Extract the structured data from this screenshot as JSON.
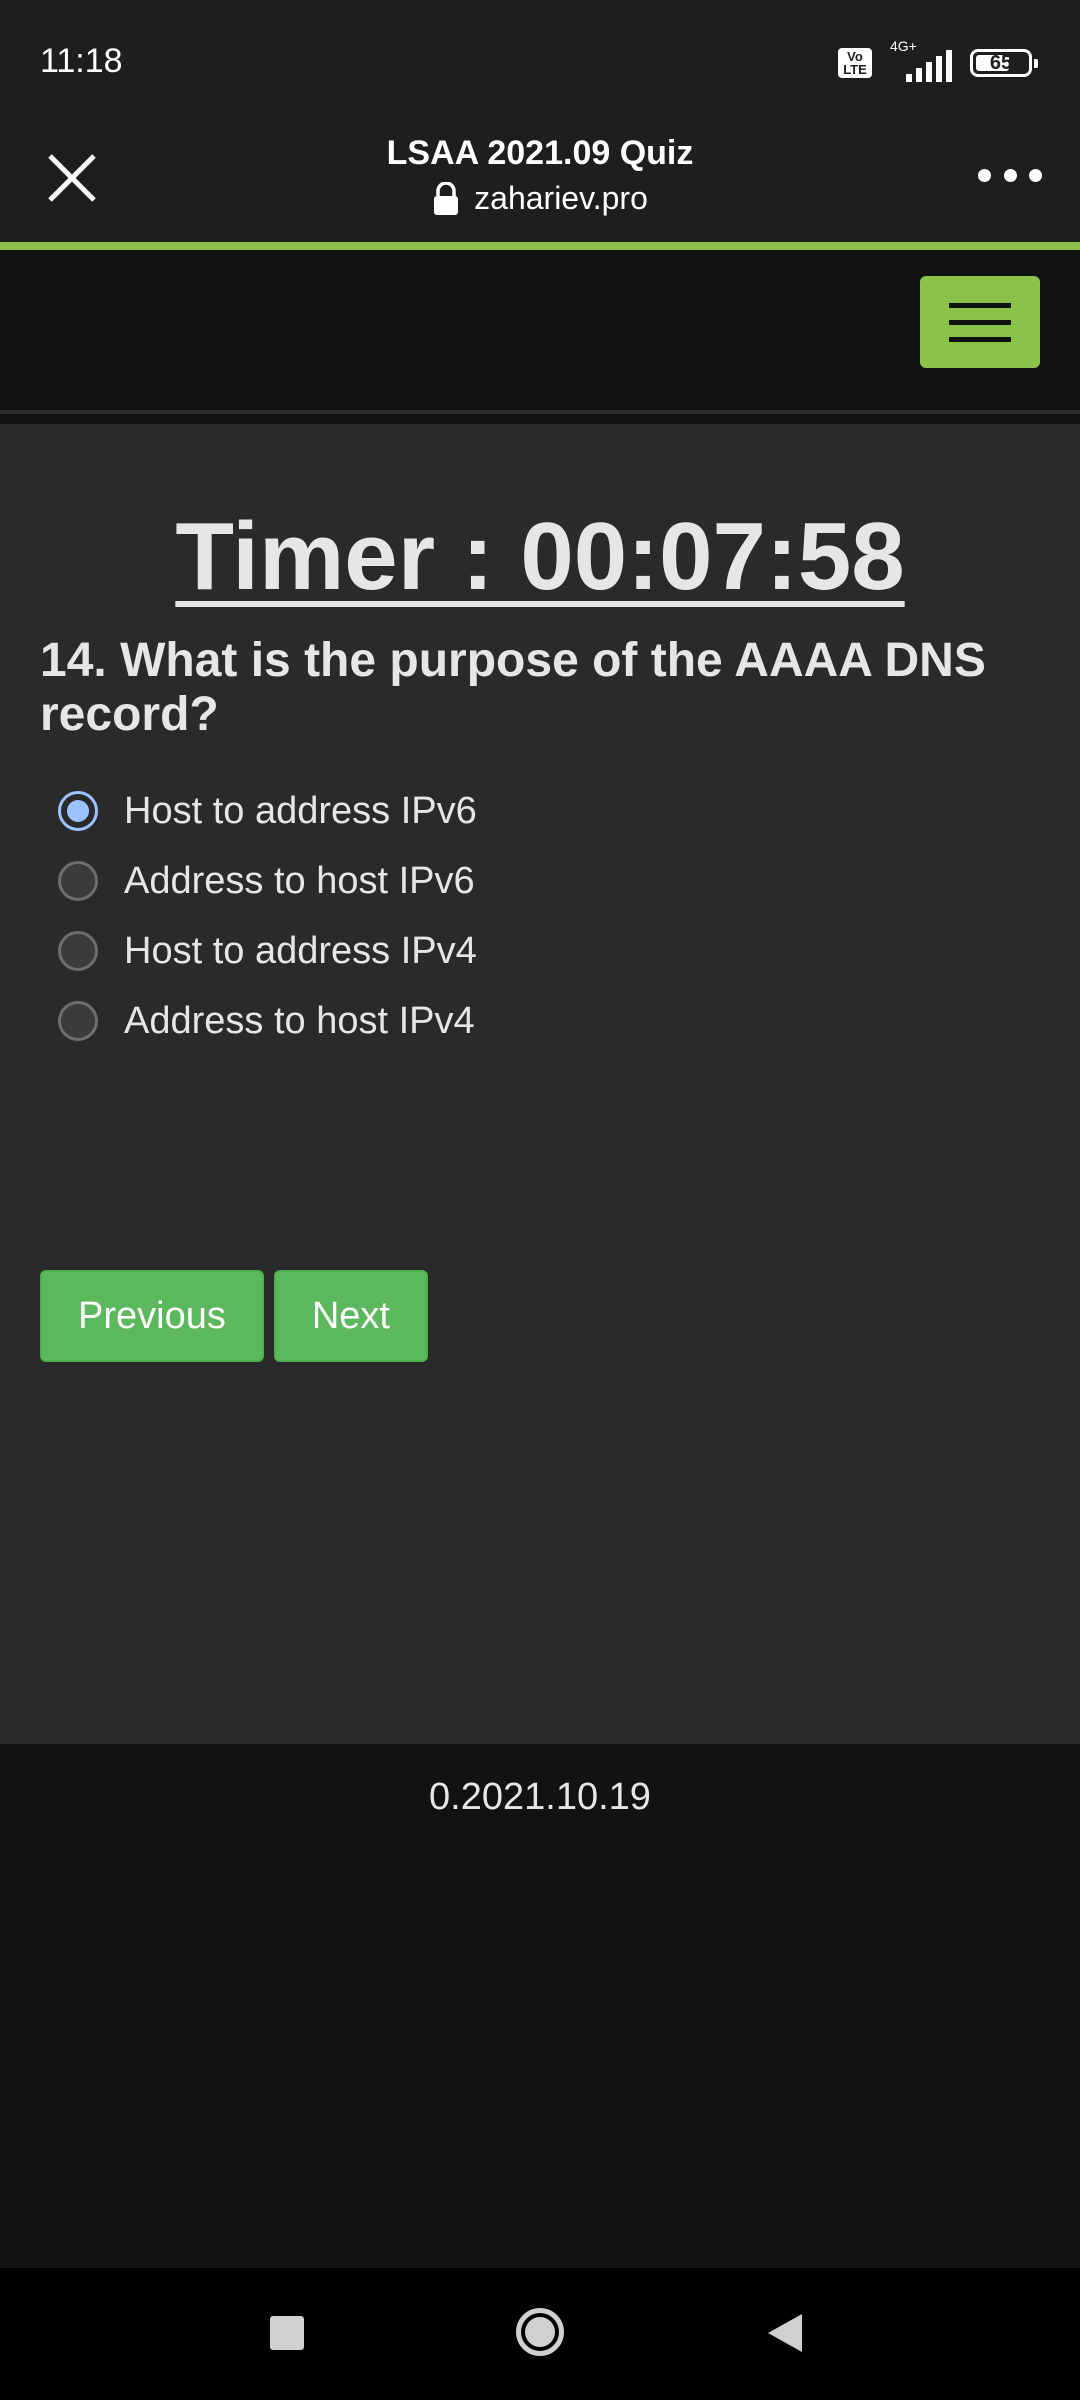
{
  "status_bar": {
    "time": "11:18",
    "volte_top": "Vo",
    "volte_bottom": "LTE",
    "network_type": "4G+",
    "battery_level": "65",
    "battery_fraction": 0.65
  },
  "browser": {
    "title": "LSAA 2021.09 Quiz",
    "url": "zahariev.pro",
    "close_icon": "close-icon",
    "menu_icon": "more-options-icon",
    "load_progress": 1.0,
    "progress_color": "#8bc34a"
  },
  "navbar": {
    "menu_icon": "hamburger-menu-icon",
    "accent_color": "#8bc34a"
  },
  "quiz": {
    "timer": "Timer : 00:07:58",
    "question": "14. What is the purpose of the AAAA DNS record?",
    "options": [
      {
        "label": "Host to address IPv6",
        "selected": true
      },
      {
        "label": "Address to host IPv6",
        "selected": false
      },
      {
        "label": "Host to address IPv4",
        "selected": false
      },
      {
        "label": "Address to host IPv4",
        "selected": false
      }
    ],
    "previous_label": "Previous",
    "next_label": "Next",
    "button_color": "#5cb85c"
  },
  "footer": {
    "version": "0.2021.10.19"
  },
  "system_nav": {
    "recents_icon": "square-recents-icon",
    "home_icon": "circle-home-icon",
    "back_icon": "triangle-back-icon"
  }
}
